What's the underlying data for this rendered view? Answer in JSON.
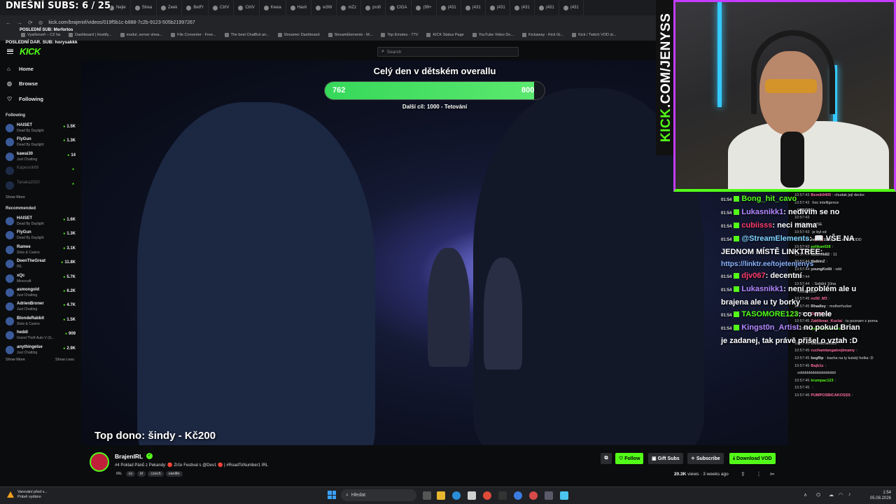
{
  "overlay": {
    "subs": "DNEŠNÍ SUBS: 6 / 25",
    "last_sub": "POSLEDNÍ SUB: Merfortos",
    "last_dar": "POSLEDNÍ DAR. SUB: horysakkk"
  },
  "tabs": [
    "Nejle",
    "Strea",
    "Zeek",
    "BetFr",
    "CtrlV",
    "CtrlV",
    "Kewa",
    "Havli",
    "w3W",
    "mZz",
    "profi",
    "CIGA",
    "(99+",
    "(431",
    "(431",
    "(431",
    "(431",
    "(431",
    "(431"
  ],
  "url": "kick.com/brajenirl/videos/019f5b1c-b988-7c2b-9123-505b21997267",
  "bookmarks": [
    "Vyaťkoveň – CZ ha",
    "Dashboard | Hostify...",
    "modul, server strea...",
    "File Converter - Free...",
    "The best ChatBot an...",
    "Streamer Dashboard",
    "StreamElements - M...",
    "Top Emotes - 7TV",
    "KICK Status Page",
    "YouTube Video Do...",
    "Kickaway - Kick Gi...",
    "Kick / Twitch VOD st..."
  ],
  "search": {
    "placeholder": "Search"
  },
  "nav": {
    "home": "Home",
    "browse": "Browse",
    "following": "Following"
  },
  "following_section": {
    "header": "Following",
    "channels": [
      {
        "name": "HAISET",
        "game": "Dead By Daylight",
        "viewers": "1.5K",
        "online": true
      },
      {
        "name": "FlyGun",
        "game": "Dead By Daylight",
        "viewers": "1.3K",
        "online": true
      },
      {
        "name": "kawai30",
        "game": "Just Chatting",
        "viewers": "14",
        "online": true
      },
      {
        "name": "Kapesnik69",
        "game": "",
        "viewers": "",
        "online": false
      },
      {
        "name": "Tanaka2020",
        "game": "",
        "viewers": "",
        "online": false
      }
    ],
    "show_more": "Show More"
  },
  "recommended_section": {
    "header": "Recommended",
    "channels": [
      {
        "name": "HAISET",
        "game": "Dead By Daylight",
        "viewers": "1.6K"
      },
      {
        "name": "FlyGun",
        "game": "Dead By Daylight",
        "viewers": "1.3K"
      },
      {
        "name": "Ramee",
        "game": "Slots & Casino",
        "viewers": "3.1K"
      },
      {
        "name": "DeenTheGreat",
        "game": "IRL",
        "viewers": "11.8K"
      },
      {
        "name": "xQc",
        "game": "Minecraft",
        "viewers": "5.7K"
      },
      {
        "name": "asmongold",
        "game": "Just Chatting",
        "viewers": "6.2K"
      },
      {
        "name": "AdrienBroner",
        "game": "Just Chatting",
        "viewers": "4.7K"
      },
      {
        "name": "BlondeRabbit",
        "game": "Slots & Casino",
        "viewers": "1.5K"
      },
      {
        "name": "heddi",
        "game": "Grand Theft Auto V (G...",
        "viewers": "909"
      },
      {
        "name": "anythingelse",
        "game": "Just Chatting",
        "viewers": "2.9K"
      }
    ],
    "show_more": "Show More",
    "show_less": "Show Less"
  },
  "goal": {
    "title": "Celý den v dětském overallu",
    "current": "762",
    "target": "800",
    "progress_fraction": 0.9525,
    "next": "Další cíl: 1000 - Tetování"
  },
  "top_dono": "Top dono: šindy - Kč200",
  "webcam": {
    "vertical_text_kick": "KICK",
    "vertical_text_rest": ".COM/JENYSS"
  },
  "chat_big": [
    {
      "time": "01:54",
      "user": "Bong_hit_cavo",
      "user_color": "#53fc18",
      "text": ""
    },
    {
      "time": "01:54",
      "user": "Lukasnikk1",
      "user_color": "#b388ff",
      "text": ": nedivim se no"
    },
    {
      "time": "01:54",
      "user": "cubiisss",
      "user_color": "#ff3b6b",
      "text": ": neci mama"
    },
    {
      "time": "01:54",
      "user": "@StreamElements",
      "user_color": "#7fd3ff",
      "text": ": 📖 VŠE NA JEDNOM MÍSTĚ LINKTREE:"
    },
    {
      "time": "",
      "user": "",
      "user_color": "#8ab4ff",
      "text": "https://linktr.ee/tojetenjenys"
    },
    {
      "time": "01:54",
      "user": "djv067",
      "user_color": "#ff3b6b",
      "text": ": decentní"
    },
    {
      "time": "01:54",
      "user": "Lukasnikk1",
      "user_color": "#b388ff",
      "text": ": není problém ale u brajena ale u ty borky"
    },
    {
      "time": "01:54",
      "user": "TASOMORE123",
      "user_color": "#53fc18",
      "text": ": co mele"
    },
    {
      "time": "01:54",
      "user": "Kingst0n_Artist",
      "user_color": "#b388ff",
      "text": ": no pokud Brian je zadanej, tak právě přišel o vztah :D"
    }
  ],
  "chat_small": [
    {
      "time": "10:57:43",
      "user": "Bemik9405",
      "user_color": "#ff6b9d",
      "text": ": chudak její decko"
    },
    {
      "time": "10:57:43",
      "user": "",
      "user_color": "#ddd",
      "text": "hoc intelligence"
    },
    {
      "time": "",
      "user": "",
      "user_color": "#ddd",
      "text": "nepobrala"
    },
    {
      "time": "10:57:43",
      "user": "",
      "user_color": "#ddd",
      "text": ""
    },
    {
      "time": "10:57:43",
      "user": "",
      "user_color": "#ddd",
      "text": ": VŠE"
    },
    {
      "time": "10:57:43",
      "user": "",
      "user_color": "#ddd",
      "text": "je byl xd"
    },
    {
      "time": "10:57:43",
      "user": "henry_1993_cz",
      "user_color": "#ddd",
      "text": ": xxxDDDDD"
    },
    {
      "time": "10:57:43",
      "user": "pelikan028",
      "user_color": "#53fc18",
      "text": ":"
    },
    {
      "time": "10:57:44",
      "user": "abuznik82",
      "user_color": "#ddd",
      "text": ": 11"
    },
    {
      "time": "10:57:44",
      "user": "HatkinZ",
      "user_color": "#ddd",
      "text": ":"
    },
    {
      "time": "10:57:44",
      "user": "youngKolili",
      "user_color": "#ddd",
      "text": ": xdd"
    },
    {
      "time": "10:57:44",
      "user": "",
      "user_color": "#ddd",
      "text": ""
    },
    {
      "time": "10:57:44",
      "user": "",
      "user_color": "#ddd",
      "text": ": Solidní 10na"
    },
    {
      "time": "",
      "user": "",
      "user_color": "#ddd",
      "text": "xdddddddd"
    },
    {
      "time": "10:57:45",
      "user": "ns50_M3",
      "user_color": "#ff6b9d",
      "text": ":"
    },
    {
      "time": "10:57:45",
      "user": "Rhadley",
      "user_color": "#ddd",
      "text": ": motherfucker"
    },
    {
      "time": "10:57:45",
      "user": "Dajo97",
      "user_color": "#ff6b9d",
      "text": ": ja"
    },
    {
      "time": "10:57:45",
      "user": "Zakliknac_Kuclai",
      "user_color": "#ff6b9d",
      "text": ": tu poznam z porna"
    },
    {
      "time": "10:57:45",
      "user": "general_hovado",
      "user_color": "#53fc18",
      "text": ":"
    },
    {
      "time": "",
      "user": "",
      "user_color": "#ddd",
      "text": ""
    },
    {
      "time": "10:57:45",
      "user": "thewitcher025",
      "user_color": "#ddd",
      "text": ":"
    },
    {
      "time": "10:57:45",
      "user": "cuchamtangatvojimamy",
      "user_color": "#ff6b9d",
      "text": ":"
    },
    {
      "time": "10:57:45",
      "user": "begflip",
      "user_color": "#ddd",
      "text": ": bacha na ty kulatý holka :D"
    },
    {
      "time": "10:57:45",
      "user": "Bajb1s",
      "user_color": "#ff6b9d",
      "text": ":"
    },
    {
      "time": "",
      "user": "",
      "user_color": "#ddd",
      "text": "xddddddddddddddddd"
    },
    {
      "time": "10:57:45",
      "user": "krumpac123",
      "user_color": "#53fc18",
      "text": ":"
    },
    {
      "time": "10:57:45",
      "user": "",
      "user_color": "#ff6b9d",
      "text": ":"
    },
    {
      "time": "10:57:46",
      "user": "PUMPOSBICAKOSSS",
      "user_color": "#ff6b9d",
      "text": ":"
    }
  ],
  "stream": {
    "streamer": "BrajenIRL",
    "title": "#4 Poklad Pánů z Pekandy: 🔴 Zrče Festival s @Dev1 🔴 | #RoadToNumber1 IRL",
    "tags": [
      "IRL",
      "cs",
      "irl",
      "czech",
      "vanlife"
    ],
    "follow": "Follow",
    "gift_subs": "Gift Subs",
    "subscribe": "Subscribe",
    "download": "Download VOD",
    "views_count": "20.3K",
    "views_label": "views",
    "ago": "3 weeks ago"
  },
  "taskbar": {
    "warning_title": "Varování před v...",
    "warning_sub": "Právě vydáno",
    "search": "Hledat",
    "time": "1:54",
    "date": "05.08.2026"
  }
}
